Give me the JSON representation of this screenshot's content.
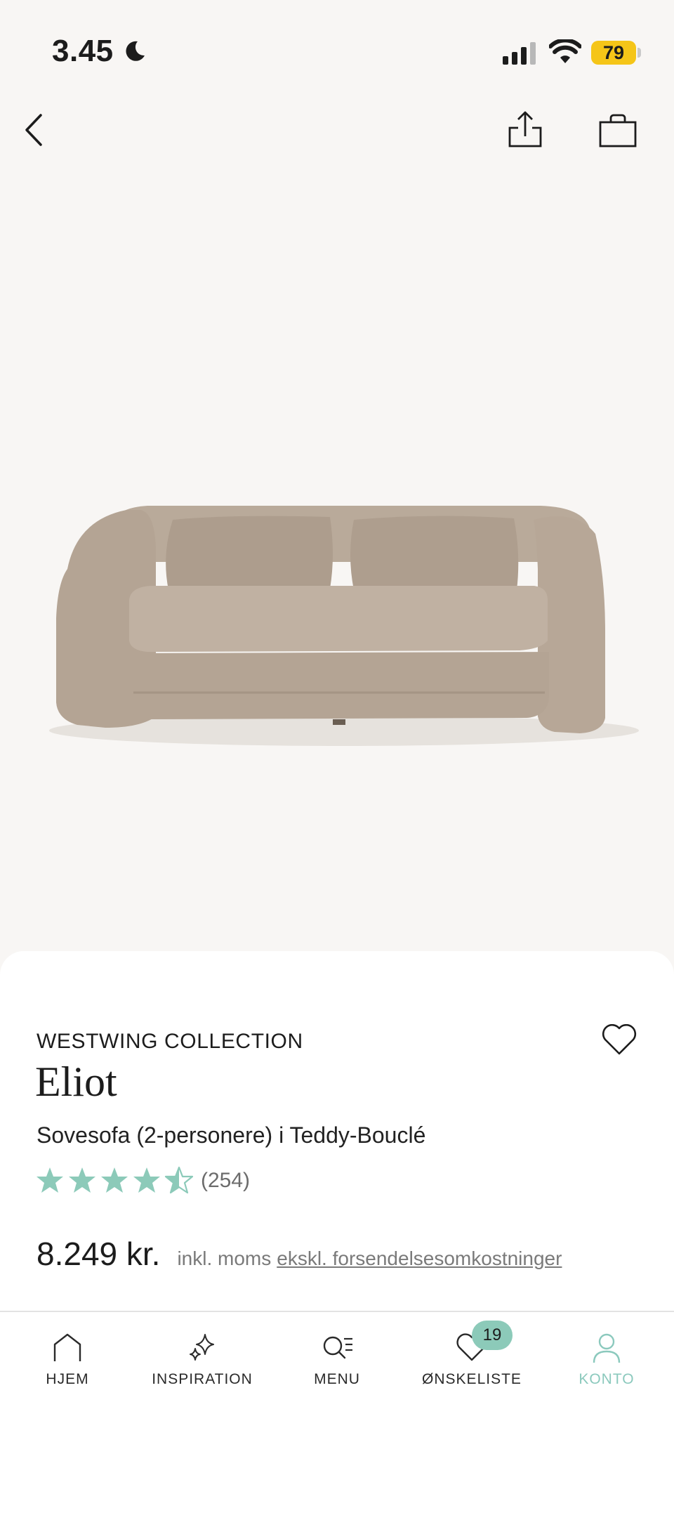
{
  "status_bar": {
    "time": "3.45",
    "battery": "79",
    "icons": [
      "moon-icon",
      "signal-icon",
      "wifi-icon",
      "battery-icon"
    ]
  },
  "top_nav": {
    "icons": [
      "back-arrow-icon",
      "share-icon",
      "shopping-bag-icon"
    ]
  },
  "product": {
    "brand": "WESTWING COLLECTION",
    "name": "Eliot",
    "subtitle": "Sovesofa (2-personere) i Teddy-Bouclé",
    "rating": 4.5,
    "review_count": "(254)",
    "price": "8.249 kr.",
    "price_vat_note": "inkl. moms",
    "price_shipping_note": "ekskl. forsendelsesomkostninger",
    "star_color": "#8ccab9"
  },
  "bottom_nav": {
    "items": [
      {
        "label": "HJEM",
        "icon": "home-icon"
      },
      {
        "label": "INSPIRATION",
        "icon": "sparkles-icon"
      },
      {
        "label": "MENU",
        "icon": "search-menu-icon"
      },
      {
        "label": "ØNSKELISTE",
        "icon": "heart-icon"
      },
      {
        "label": "KONTO",
        "icon": "user-icon"
      }
    ],
    "wishlist_count": "19",
    "active_item": "KONTO",
    "accent_color": "#8ccab9"
  }
}
